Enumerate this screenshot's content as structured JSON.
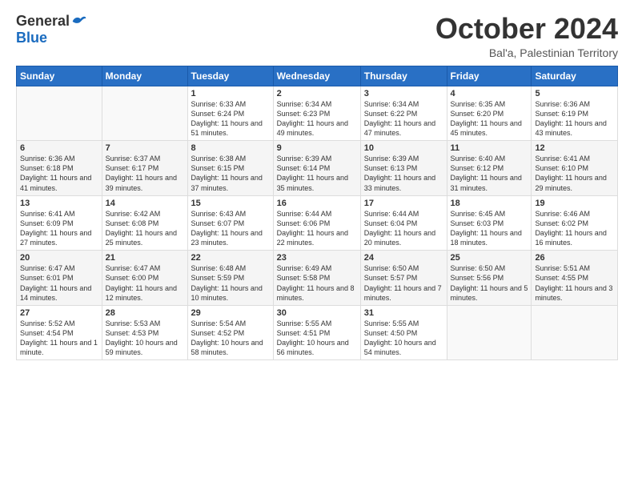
{
  "header": {
    "logo": {
      "general": "General",
      "blue": "Blue"
    },
    "title": "October 2024",
    "subtitle": "Bal'a, Palestinian Territory"
  },
  "weekdays": [
    "Sunday",
    "Monday",
    "Tuesday",
    "Wednesday",
    "Thursday",
    "Friday",
    "Saturday"
  ],
  "weeks": [
    [
      {
        "day": "",
        "info": ""
      },
      {
        "day": "",
        "info": ""
      },
      {
        "day": "1",
        "sunrise": "6:33 AM",
        "sunset": "6:24 PM",
        "daylight": "11 hours and 51 minutes."
      },
      {
        "day": "2",
        "sunrise": "6:34 AM",
        "sunset": "6:23 PM",
        "daylight": "11 hours and 49 minutes."
      },
      {
        "day": "3",
        "sunrise": "6:34 AM",
        "sunset": "6:22 PM",
        "daylight": "11 hours and 47 minutes."
      },
      {
        "day": "4",
        "sunrise": "6:35 AM",
        "sunset": "6:20 PM",
        "daylight": "11 hours and 45 minutes."
      },
      {
        "day": "5",
        "sunrise": "6:36 AM",
        "sunset": "6:19 PM",
        "daylight": "11 hours and 43 minutes."
      }
    ],
    [
      {
        "day": "6",
        "sunrise": "6:36 AM",
        "sunset": "6:18 PM",
        "daylight": "11 hours and 41 minutes."
      },
      {
        "day": "7",
        "sunrise": "6:37 AM",
        "sunset": "6:17 PM",
        "daylight": "11 hours and 39 minutes."
      },
      {
        "day": "8",
        "sunrise": "6:38 AM",
        "sunset": "6:15 PM",
        "daylight": "11 hours and 37 minutes."
      },
      {
        "day": "9",
        "sunrise": "6:39 AM",
        "sunset": "6:14 PM",
        "daylight": "11 hours and 35 minutes."
      },
      {
        "day": "10",
        "sunrise": "6:39 AM",
        "sunset": "6:13 PM",
        "daylight": "11 hours and 33 minutes."
      },
      {
        "day": "11",
        "sunrise": "6:40 AM",
        "sunset": "6:12 PM",
        "daylight": "11 hours and 31 minutes."
      },
      {
        "day": "12",
        "sunrise": "6:41 AM",
        "sunset": "6:10 PM",
        "daylight": "11 hours and 29 minutes."
      }
    ],
    [
      {
        "day": "13",
        "sunrise": "6:41 AM",
        "sunset": "6:09 PM",
        "daylight": "11 hours and 27 minutes."
      },
      {
        "day": "14",
        "sunrise": "6:42 AM",
        "sunset": "6:08 PM",
        "daylight": "11 hours and 25 minutes."
      },
      {
        "day": "15",
        "sunrise": "6:43 AM",
        "sunset": "6:07 PM",
        "daylight": "11 hours and 23 minutes."
      },
      {
        "day": "16",
        "sunrise": "6:44 AM",
        "sunset": "6:06 PM",
        "daylight": "11 hours and 22 minutes."
      },
      {
        "day": "17",
        "sunrise": "6:44 AM",
        "sunset": "6:04 PM",
        "daylight": "11 hours and 20 minutes."
      },
      {
        "day": "18",
        "sunrise": "6:45 AM",
        "sunset": "6:03 PM",
        "daylight": "11 hours and 18 minutes."
      },
      {
        "day": "19",
        "sunrise": "6:46 AM",
        "sunset": "6:02 PM",
        "daylight": "11 hours and 16 minutes."
      }
    ],
    [
      {
        "day": "20",
        "sunrise": "6:47 AM",
        "sunset": "6:01 PM",
        "daylight": "11 hours and 14 minutes."
      },
      {
        "day": "21",
        "sunrise": "6:47 AM",
        "sunset": "6:00 PM",
        "daylight": "11 hours and 12 minutes."
      },
      {
        "day": "22",
        "sunrise": "6:48 AM",
        "sunset": "5:59 PM",
        "daylight": "11 hours and 10 minutes."
      },
      {
        "day": "23",
        "sunrise": "6:49 AM",
        "sunset": "5:58 PM",
        "daylight": "11 hours and 8 minutes."
      },
      {
        "day": "24",
        "sunrise": "6:50 AM",
        "sunset": "5:57 PM",
        "daylight": "11 hours and 7 minutes."
      },
      {
        "day": "25",
        "sunrise": "6:50 AM",
        "sunset": "5:56 PM",
        "daylight": "11 hours and 5 minutes."
      },
      {
        "day": "26",
        "sunrise": "5:51 AM",
        "sunset": "4:55 PM",
        "daylight": "11 hours and 3 minutes."
      }
    ],
    [
      {
        "day": "27",
        "sunrise": "5:52 AM",
        "sunset": "4:54 PM",
        "daylight": "11 hours and 1 minute."
      },
      {
        "day": "28",
        "sunrise": "5:53 AM",
        "sunset": "4:53 PM",
        "daylight": "10 hours and 59 minutes."
      },
      {
        "day": "29",
        "sunrise": "5:54 AM",
        "sunset": "4:52 PM",
        "daylight": "10 hours and 58 minutes."
      },
      {
        "day": "30",
        "sunrise": "5:55 AM",
        "sunset": "4:51 PM",
        "daylight": "10 hours and 56 minutes."
      },
      {
        "day": "31",
        "sunrise": "5:55 AM",
        "sunset": "4:50 PM",
        "daylight": "10 hours and 54 minutes."
      },
      {
        "day": "",
        "info": ""
      },
      {
        "day": "",
        "info": ""
      }
    ]
  ]
}
